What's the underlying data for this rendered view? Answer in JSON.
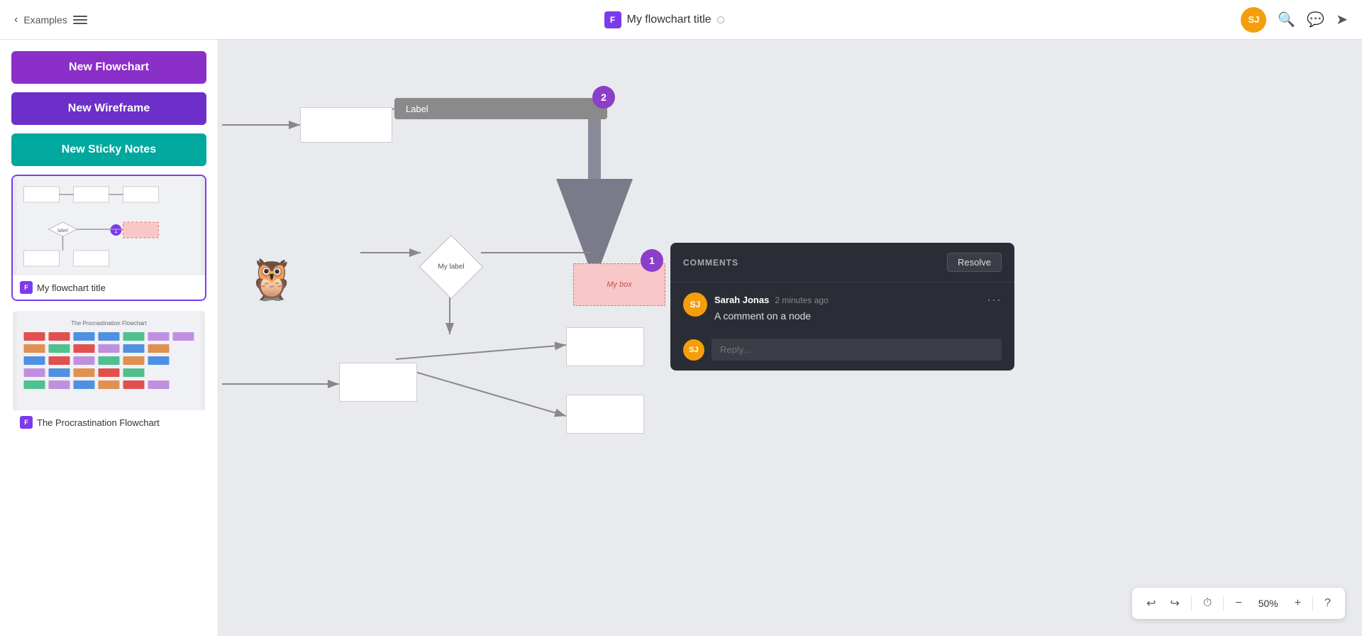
{
  "header": {
    "back_label": "Examples",
    "title": "My flowchart title",
    "logo_letter": "F",
    "avatar_initials": "SJ"
  },
  "sidebar": {
    "buttons": [
      {
        "label": "New Flowchart",
        "type": "flowchart"
      },
      {
        "label": "New Wireframe",
        "type": "wireframe"
      },
      {
        "label": "New Sticky Notes",
        "type": "sticky"
      }
    ],
    "cards": [
      {
        "label": "My flowchart title",
        "logo_letter": "F",
        "active": true
      },
      {
        "label": "The Procrastination Flowchart",
        "logo_letter": "F",
        "active": false
      }
    ]
  },
  "canvas": {
    "badge_2_label": "2",
    "badge_1_label": "1",
    "connector_label": "Label",
    "diamond_label": "My label",
    "pink_box_label": "My box"
  },
  "comments": {
    "title": "COMMENTS",
    "resolve_label": "Resolve",
    "comment_author": "Sarah Jonas",
    "comment_time": "2 minutes ago",
    "comment_text": "A comment on a node",
    "reply_placeholder": "Reply...",
    "author_initials": "SJ",
    "more_icon": "···"
  },
  "toolbar": {
    "undo_label": "↩",
    "redo_label": "↪",
    "history_label": "⏱",
    "zoom_out_label": "−",
    "zoom_level": "50%",
    "zoom_in_label": "+",
    "help_label": "?"
  }
}
